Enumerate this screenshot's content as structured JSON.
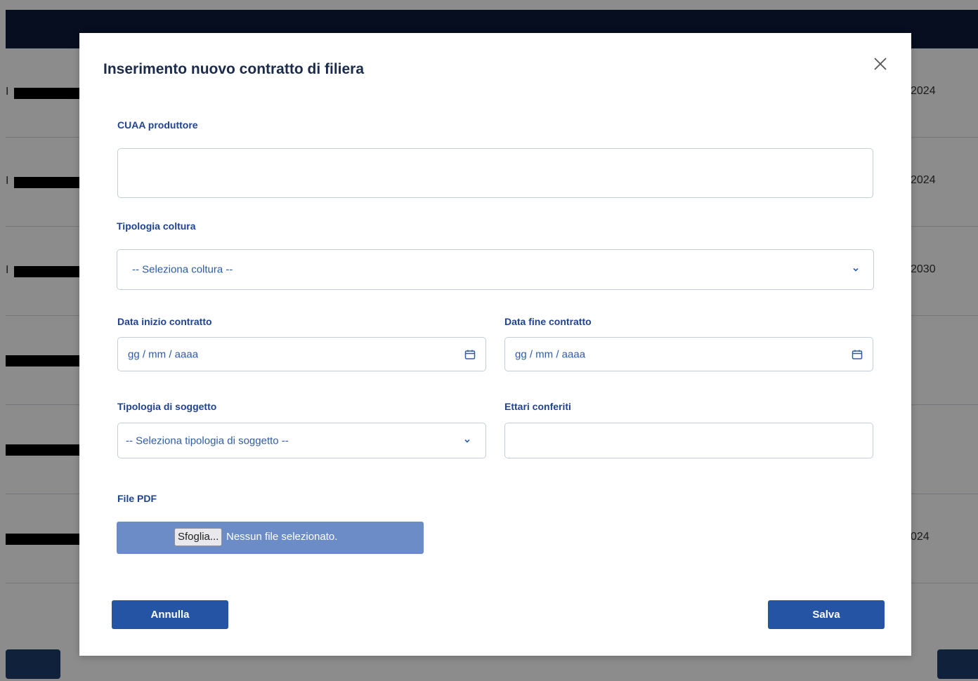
{
  "background": {
    "rows": [
      {
        "lead": "I",
        "year": "2024"
      },
      {
        "lead": "I",
        "year": "2024"
      },
      {
        "lead": "I",
        "year": "2030"
      },
      {
        "lead": "",
        "year": ""
      },
      {
        "lead": "",
        "year": ""
      },
      {
        "lead": "",
        "year": "024"
      }
    ]
  },
  "modal": {
    "title": "Inserimento nuovo contratto di filiera",
    "close_icon": "close-icon",
    "fields": {
      "cuaa": {
        "label": "CUAA produttore",
        "value": ""
      },
      "coltura": {
        "label": "Tipologia coltura",
        "selected": "-- Seleziona coltura --"
      },
      "data_inizio": {
        "label": "Data inizio contratto",
        "placeholder": "gg / mm / aaaa"
      },
      "data_fine": {
        "label": "Data fine contratto",
        "placeholder": "gg / mm / aaaa"
      },
      "soggetto": {
        "label": "Tipologia di soggetto",
        "selected": "-- Seleziona tipologia di soggetto --"
      },
      "ettari": {
        "label": "Ettari conferiti",
        "value": ""
      },
      "file": {
        "label": "File PDF",
        "button": "Sfoglia...",
        "status": "Nessun file selezionato."
      }
    },
    "actions": {
      "cancel": "Annulla",
      "save": "Salva"
    },
    "colors": {
      "accent": "#2554a5",
      "label": "#1f4390",
      "file_box": "#6b8cc7"
    }
  }
}
